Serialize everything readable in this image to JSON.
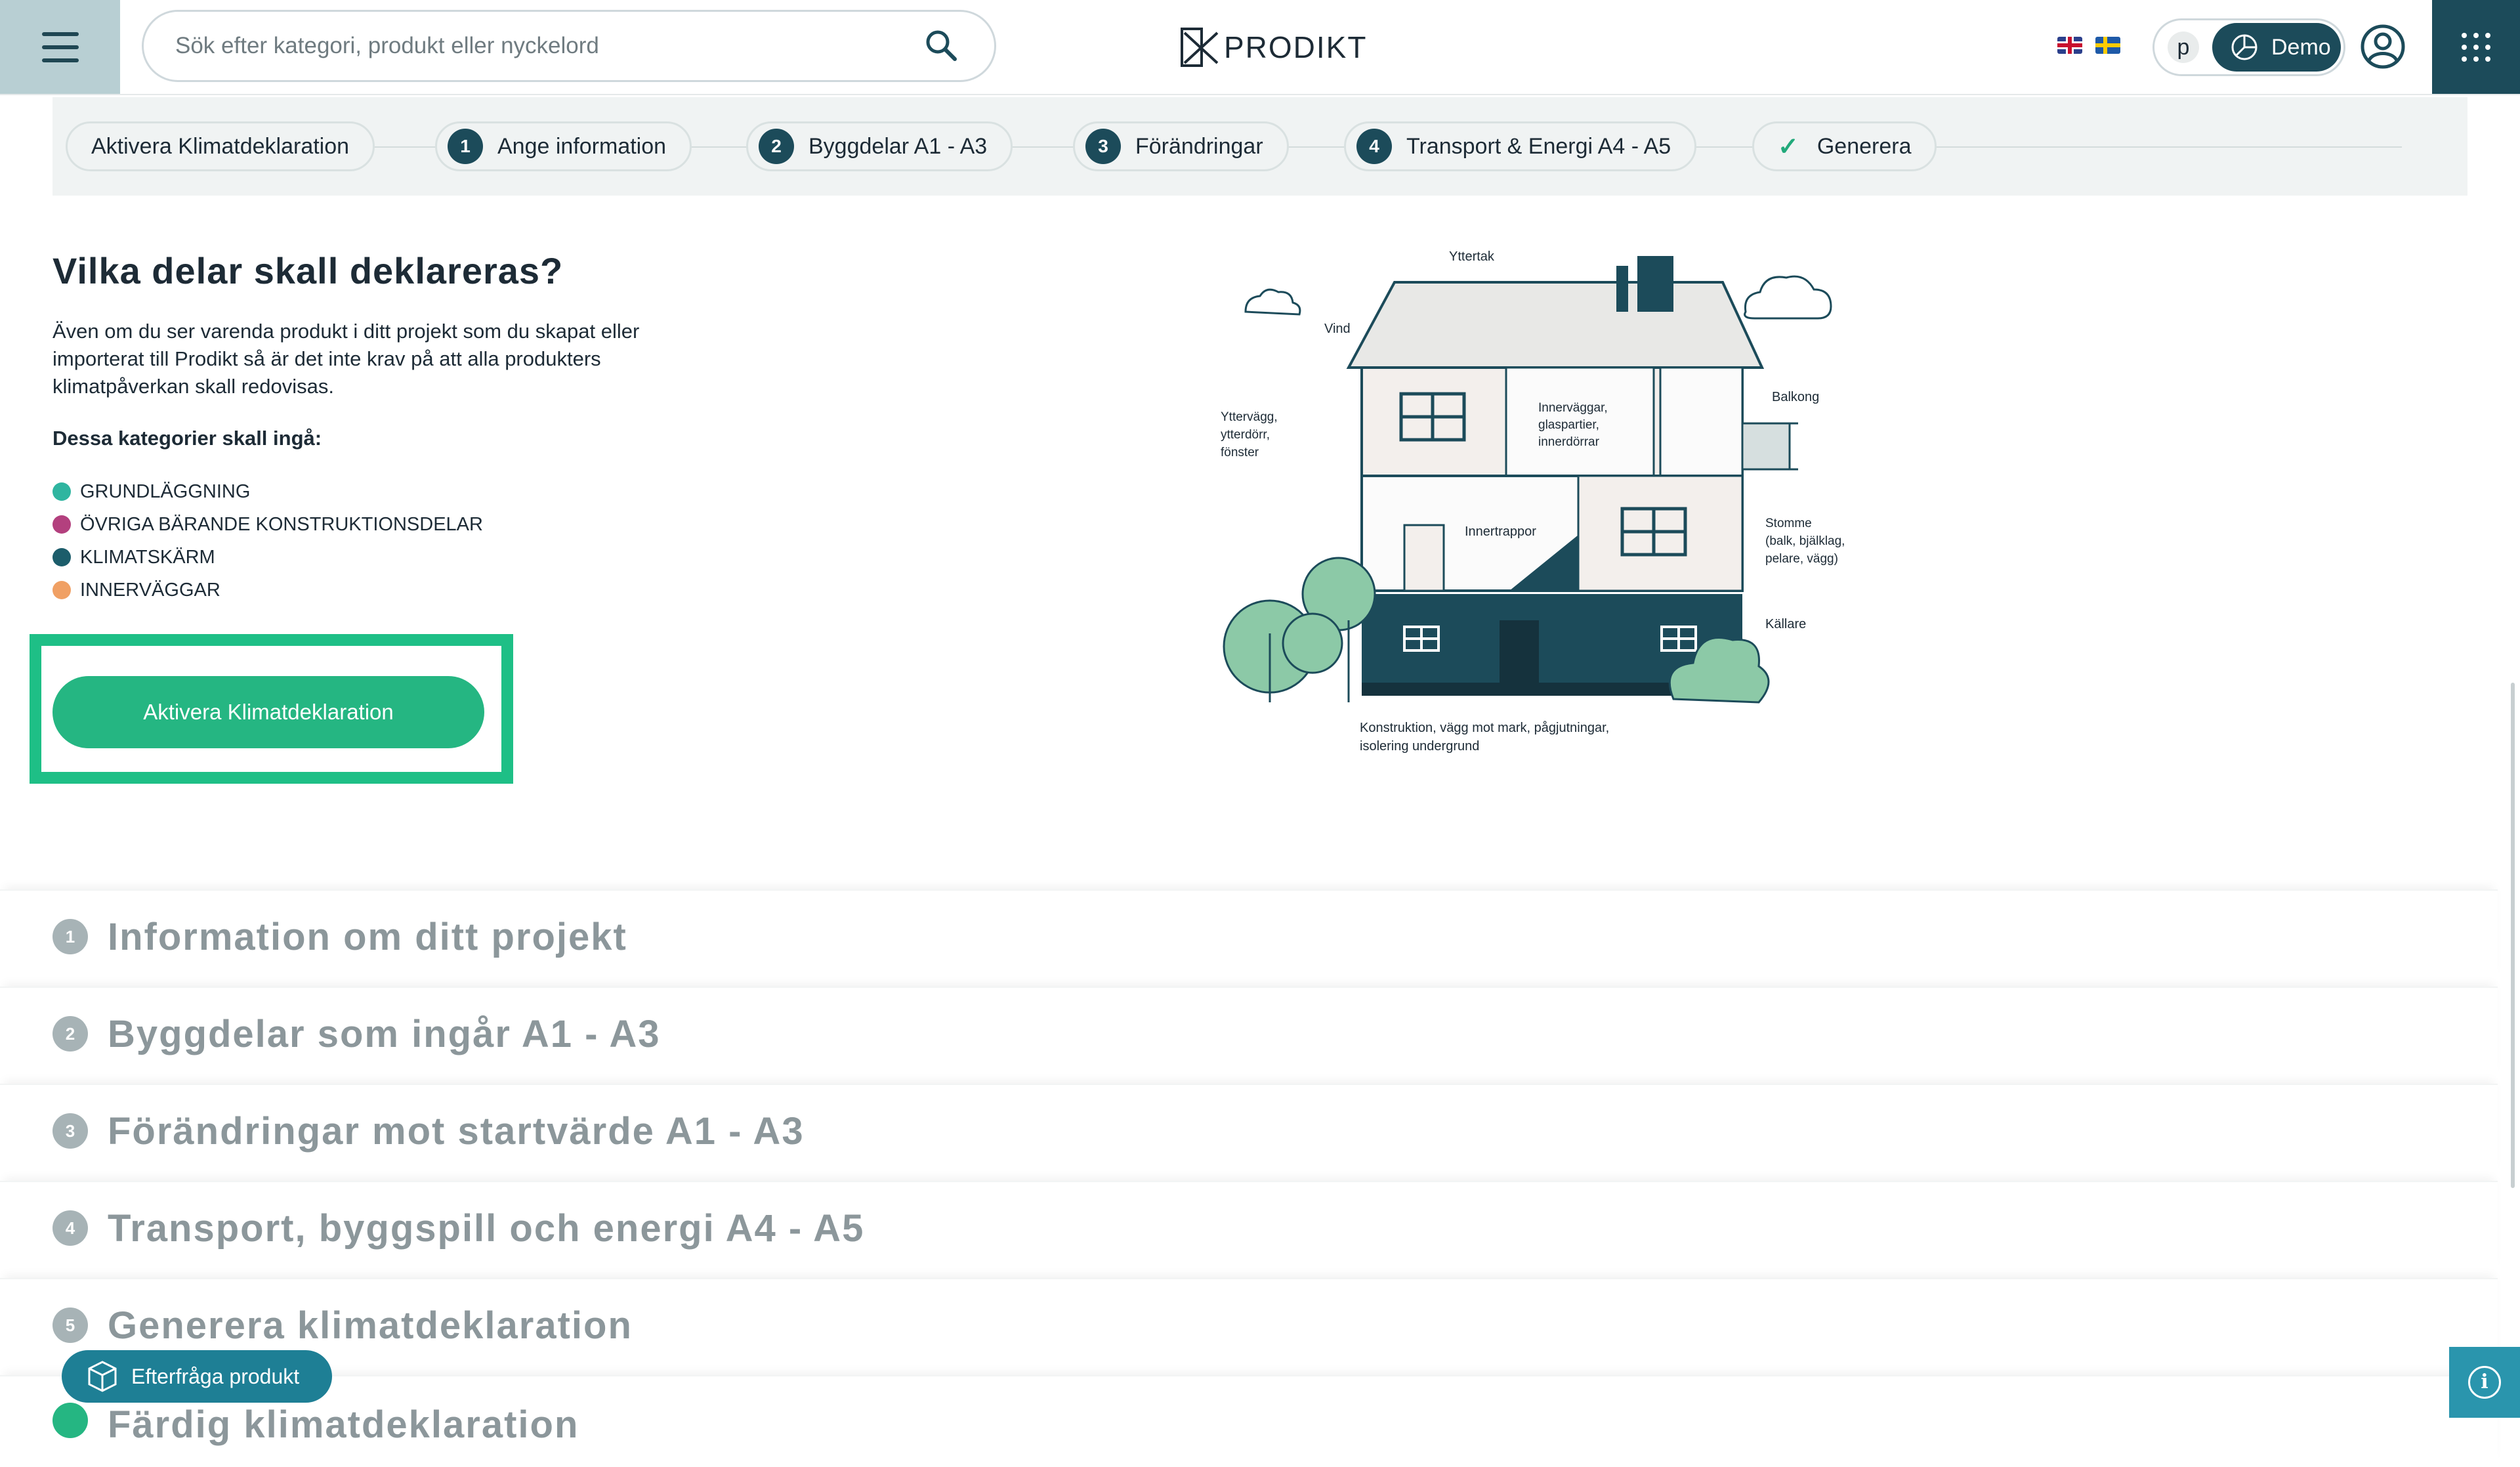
{
  "header": {
    "search_placeholder": "Sök efter kategori, produkt eller nyckelord",
    "logo_text": "PRODIKT",
    "demo_initial": "p",
    "demo_label": "Demo"
  },
  "stepper": {
    "steps": [
      {
        "number": "",
        "label": "Aktivera Klimatdeklaration"
      },
      {
        "number": "1",
        "label": "Ange information"
      },
      {
        "number": "2",
        "label": "Byggdelar A1 - A3"
      },
      {
        "number": "3",
        "label": "Förändringar"
      },
      {
        "number": "4",
        "label": "Transport & Energi A4 - A5"
      },
      {
        "number": "",
        "label": "Generera"
      }
    ]
  },
  "intro": {
    "title": "Vilka delar skall deklareras?",
    "text": "Även om du ser varenda produkt i ditt projekt som du skapat eller importerat till Prodikt så är det inte krav på att alla produkters klimatpåverkan skall redovisas.",
    "categories_heading": "Dessa kategorier skall ingå:",
    "categories": [
      {
        "label": "GRUNDLÄGGNING",
        "color": "#2fb5a0"
      },
      {
        "label": "ÖVRIGA BÄRANDE KONSTRUKTIONSDELAR",
        "color": "#b3407e"
      },
      {
        "label": "KLIMATSKÄRM",
        "color": "#1c5d6b"
      },
      {
        "label": "INNERVÄGGAR",
        "color": "#f0a064"
      }
    ],
    "cta_label": "Aktivera Klimatdeklaration"
  },
  "illustration": {
    "labels": {
      "yttertak": "Yttertak",
      "vind": "Vind",
      "balkong": "Balkong",
      "yttervagg": [
        "Yttervägg,",
        "ytterdörr,",
        "fönster"
      ],
      "innervaggar": [
        "Innerväggar,",
        "glaspartier,",
        "innerdörrar"
      ],
      "innertrappor": "Innertrappor",
      "stomme": [
        "Stomme",
        "(balk, bjälklag,",
        "pelare, vägg)"
      ],
      "kallare": "Källare",
      "konstruktion": [
        "Konstruktion, vägg mot mark, pågjutningar,",
        "isolering undergrund"
      ]
    }
  },
  "accordion": [
    {
      "number": "1",
      "title": "Information om ditt projekt"
    },
    {
      "number": "2",
      "title": "Byggdelar som ingår A1 - A3"
    },
    {
      "number": "3",
      "title": "Förändringar mot startvärde A1 - A3"
    },
    {
      "number": "4",
      "title": "Transport, byggspill och energi A4 - A5"
    },
    {
      "number": "5",
      "title": "Generera klimatdeklaration"
    },
    {
      "number": "",
      "title": "Färdig klimatdeklaration"
    }
  ],
  "floating": {
    "ask_product": "Efterfråga produkt",
    "info_icon": "i"
  },
  "colors": {
    "brand_dark": "#1c4b5a",
    "accent_green": "#25b682",
    "highlight_frame": "#1ebf86"
  }
}
